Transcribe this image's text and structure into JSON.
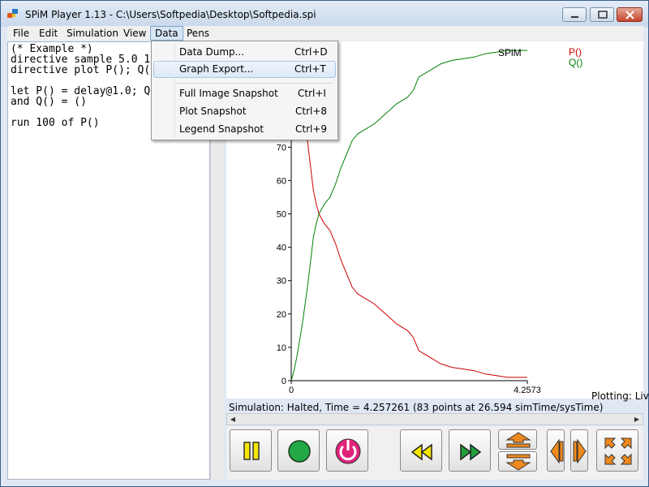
{
  "window": {
    "title": "SPiM Player 1.13 - C:\\Users\\Softpedia\\Desktop\\Softpedia.spi"
  },
  "menu": {
    "items": [
      "File",
      "Edit",
      "Simulation",
      "View",
      "Data",
      "Pens"
    ],
    "open_item": "Data"
  },
  "data_menu": {
    "items": [
      {
        "label": "Data Dump...",
        "shortcut": "Ctrl+D"
      },
      {
        "label": "Graph Export...",
        "shortcut": "Ctrl+T"
      },
      {
        "label": "Full Image Snapshot",
        "shortcut": "Ctrl+I"
      },
      {
        "label": "Plot Snapshot",
        "shortcut": "Ctrl+8"
      },
      {
        "label": "Legend Snapshot",
        "shortcut": "Ctrl+9"
      }
    ],
    "highlighted": "Graph Export..."
  },
  "editor": {
    "lines": [
      "(* Example *)",
      "directive sample 5.0 1",
      "directive plot P(); Q(",
      "",
      "let P() = delay@1.0; Q",
      "and Q() = ()",
      "",
      "run 100 of P()"
    ]
  },
  "status": {
    "text": "Simulation: Halted, Time = 4.257261 (83 points at 26.594 simTime/sysTime)",
    "plotting": "Plotting: Liv"
  },
  "toolbar": {
    "buttons": [
      "pause-icon",
      "record-icon",
      "power-icon",
      "rewind-icon",
      "fast-forward-icon",
      "zoom-in-vertical-icon",
      "zoom-out-vertical-icon",
      "zoom-in-horizontal-icon",
      "zoom-out-horizontal-icon",
      "fit-to-screen-icon"
    ],
    "colors": {
      "pause": "#f5e600",
      "record": "#22a845",
      "power": "#e0247a",
      "arrows": "#f08a1c",
      "media": "#1f9f3a"
    }
  },
  "chart_data": {
    "type": "line",
    "title": "SPiM",
    "xlim": [
      0,
      4.2573
    ],
    "ylim": [
      0,
      100
    ],
    "x_tick_labels": [
      "0",
      "4.2573"
    ],
    "y_ticks": [
      0,
      10,
      20,
      30,
      40,
      50,
      60,
      70
    ],
    "series": [
      {
        "name": "P()",
        "color": "#cc0000",
        "x": [
          0,
          0.05,
          0.1,
          0.15,
          0.2,
          0.25,
          0.3,
          0.35,
          0.4,
          0.45,
          0.5,
          0.6,
          0.7,
          0.8,
          0.9,
          1.0,
          1.1,
          1.2,
          1.3,
          1.5,
          1.7,
          1.9,
          2.1,
          2.2,
          2.3,
          2.5,
          2.7,
          2.9,
          3.1,
          3.3,
          3.5,
          3.7,
          3.9,
          4.0,
          4.2573
        ],
        "y": [
          100,
          97,
          93,
          88,
          83,
          77,
          71,
          64,
          57,
          53,
          50,
          47,
          45,
          41,
          36,
          32,
          28,
          26,
          25,
          23,
          20,
          17,
          15,
          13,
          9,
          7,
          5,
          4,
          3.5,
          3,
          2,
          1.5,
          1,
          1,
          1
        ]
      },
      {
        "name": "Q()",
        "color": "#008000",
        "x": [
          0,
          0.05,
          0.1,
          0.15,
          0.2,
          0.25,
          0.3,
          0.35,
          0.4,
          0.45,
          0.5,
          0.6,
          0.7,
          0.8,
          0.9,
          1.0,
          1.1,
          1.2,
          1.3,
          1.5,
          1.7,
          1.9,
          2.1,
          2.2,
          2.3,
          2.5,
          2.7,
          2.9,
          3.1,
          3.3,
          3.5,
          3.7,
          3.9,
          4.0,
          4.2573
        ],
        "y": [
          0,
          3,
          7,
          12,
          17,
          23,
          29,
          36,
          43,
          47,
          50,
          53,
          55,
          59,
          64,
          68,
          72,
          74,
          75,
          77,
          80,
          83,
          85,
          87,
          91,
          93,
          95,
          96,
          96.5,
          97,
          98,
          98.5,
          99,
          99,
          99
        ]
      }
    ],
    "legend": "top-right",
    "grid": false
  }
}
